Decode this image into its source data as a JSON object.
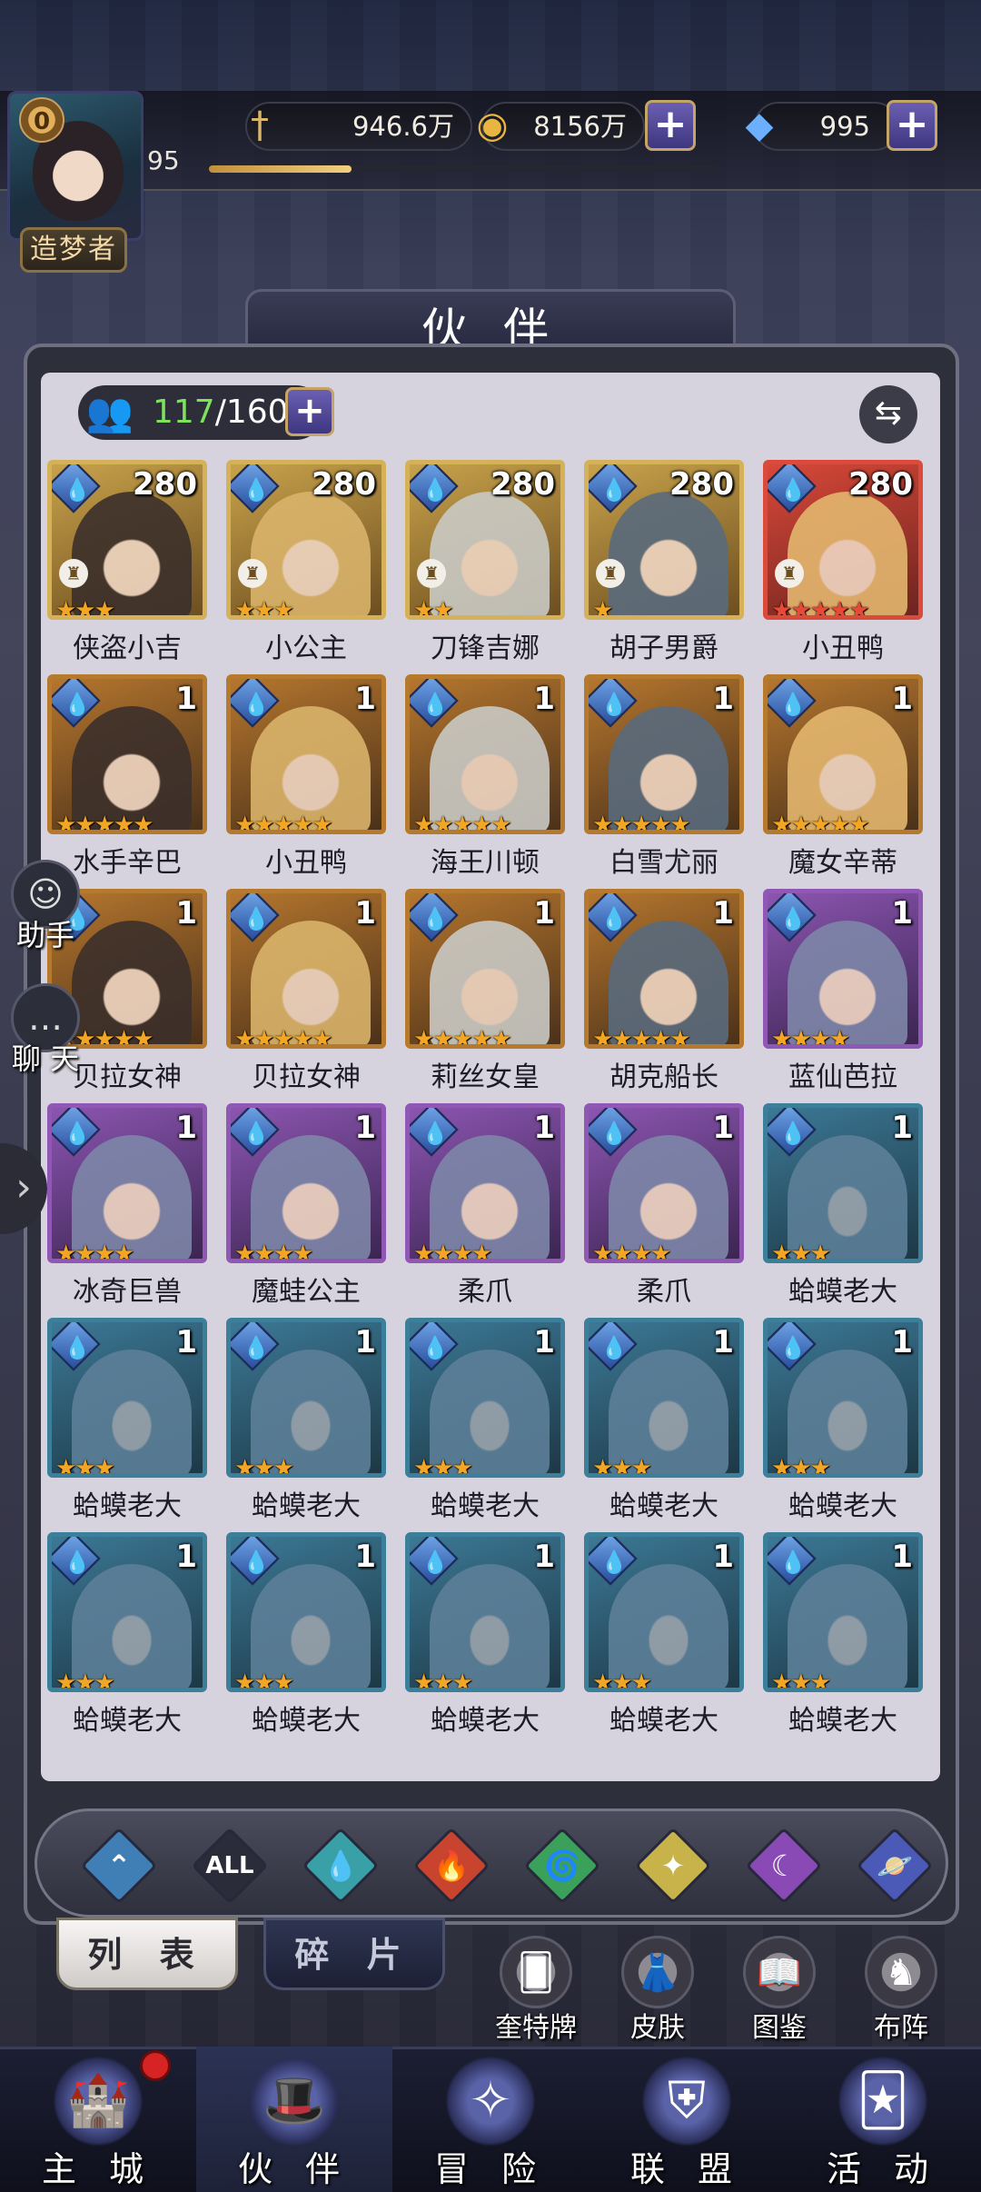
{
  "header": {
    "vip_level": "0",
    "player_level": "95",
    "rank_label": "造梦者",
    "exp_fraction": 0.28,
    "resources": [
      {
        "icon": "sword-icon",
        "value": "946.6万"
      },
      {
        "icon": "gold-coin-icon",
        "value": "8156万"
      },
      {
        "icon": "diamond-icon",
        "value": "995"
      }
    ]
  },
  "page": {
    "title": "伙 伴",
    "count_current": "117",
    "count_total": "/160"
  },
  "heroes": [
    {
      "name": "侠盗小吉",
      "level": "280",
      "stars": 3,
      "frame": "gold",
      "tower": true
    },
    {
      "name": "小公主",
      "level": "280",
      "stars": 3,
      "frame": "gold",
      "tower": true
    },
    {
      "name": "刀锋吉娜",
      "level": "280",
      "stars": 2,
      "frame": "gold",
      "tower": true
    },
    {
      "name": "胡子男爵",
      "level": "280",
      "stars": 1,
      "frame": "gold",
      "tower": true
    },
    {
      "name": "小丑鸭",
      "level": "280",
      "stars": 5,
      "frame": "red",
      "tower": true
    },
    {
      "name": "水手辛巴",
      "level": "1",
      "stars": 5,
      "frame": "orange",
      "tower": false
    },
    {
      "name": "小丑鸭",
      "level": "1",
      "stars": 5,
      "frame": "orange",
      "tower": false
    },
    {
      "name": "海王川顿",
      "level": "1",
      "stars": 5,
      "frame": "orange",
      "tower": false
    },
    {
      "name": "白雪尤丽",
      "level": "1",
      "stars": 5,
      "frame": "orange",
      "tower": false
    },
    {
      "name": "魔女辛蒂",
      "level": "1",
      "stars": 5,
      "frame": "orange",
      "tower": false
    },
    {
      "name": "贝拉女神",
      "level": "1",
      "stars": 5,
      "frame": "orange",
      "tower": false
    },
    {
      "name": "贝拉女神",
      "level": "1",
      "stars": 5,
      "frame": "orange",
      "tower": false
    },
    {
      "name": "莉丝女皇",
      "level": "1",
      "stars": 5,
      "frame": "orange",
      "tower": false
    },
    {
      "name": "胡克船长",
      "level": "1",
      "stars": 5,
      "frame": "orange",
      "tower": false
    },
    {
      "name": "蓝仙芭拉",
      "level": "1",
      "stars": 4,
      "frame": "purple",
      "tower": false
    },
    {
      "name": "冰奇巨兽",
      "level": "1",
      "stars": 4,
      "frame": "purple",
      "tower": false
    },
    {
      "name": "魔蛙公主",
      "level": "1",
      "stars": 4,
      "frame": "purple",
      "tower": false
    },
    {
      "name": "柔爪",
      "level": "1",
      "stars": 4,
      "frame": "purple",
      "tower": false
    },
    {
      "name": "柔爪",
      "level": "1",
      "stars": 4,
      "frame": "purple",
      "tower": false
    },
    {
      "name": "蛤蟆老大",
      "level": "1",
      "stars": 3,
      "frame": "teal",
      "tower": false
    },
    {
      "name": "蛤蟆老大",
      "level": "1",
      "stars": 3,
      "frame": "teal",
      "tower": false
    },
    {
      "name": "蛤蟆老大",
      "level": "1",
      "stars": 3,
      "frame": "teal",
      "tower": false
    },
    {
      "name": "蛤蟆老大",
      "level": "1",
      "stars": 3,
      "frame": "teal",
      "tower": false
    },
    {
      "name": "蛤蟆老大",
      "level": "1",
      "stars": 3,
      "frame": "teal",
      "tower": false
    },
    {
      "name": "蛤蟆老大",
      "level": "1",
      "stars": 3,
      "frame": "teal",
      "tower": false
    },
    {
      "name": "蛤蟆老大",
      "level": "1",
      "stars": 3,
      "frame": "teal",
      "tower": false
    },
    {
      "name": "蛤蟆老大",
      "level": "1",
      "stars": 3,
      "frame": "teal",
      "tower": false
    },
    {
      "name": "蛤蟆老大",
      "level": "1",
      "stars": 3,
      "frame": "teal",
      "tower": false
    },
    {
      "name": "蛤蟆老大",
      "level": "1",
      "stars": 3,
      "frame": "teal",
      "tower": false
    },
    {
      "name": "蛤蟆老大",
      "level": "1",
      "stars": 3,
      "frame": "teal",
      "tower": false
    }
  ],
  "side_buttons": {
    "assistant": "助手",
    "chat": "聊 天"
  },
  "filters": [
    {
      "icon": "all-element-icon",
      "label": "",
      "color": "#3f7fb6"
    },
    {
      "icon": "all-icon",
      "label": "ALL",
      "color": "#2a2c3a"
    },
    {
      "icon": "water-drop-icon",
      "label": "",
      "color": "#3aa0a8"
    },
    {
      "icon": "fire-icon",
      "label": "",
      "color": "#c8442e"
    },
    {
      "icon": "wind-icon",
      "label": "",
      "color": "#3aa05a"
    },
    {
      "icon": "light-icon",
      "label": "",
      "color": "#c8b24a"
    },
    {
      "icon": "dark-moon-icon",
      "label": "",
      "color": "#8a4ab6"
    },
    {
      "icon": "planet-icon",
      "label": "",
      "color": "#4a5ab6"
    }
  ],
  "tabs": {
    "list": "列 表",
    "fragments": "碎 片"
  },
  "sub_buttons": [
    "奎特牌",
    "皮肤",
    "图鉴",
    "布阵"
  ],
  "nav": [
    "主 城",
    "伙 伴",
    "冒 险",
    "联 盟",
    "活 动"
  ]
}
